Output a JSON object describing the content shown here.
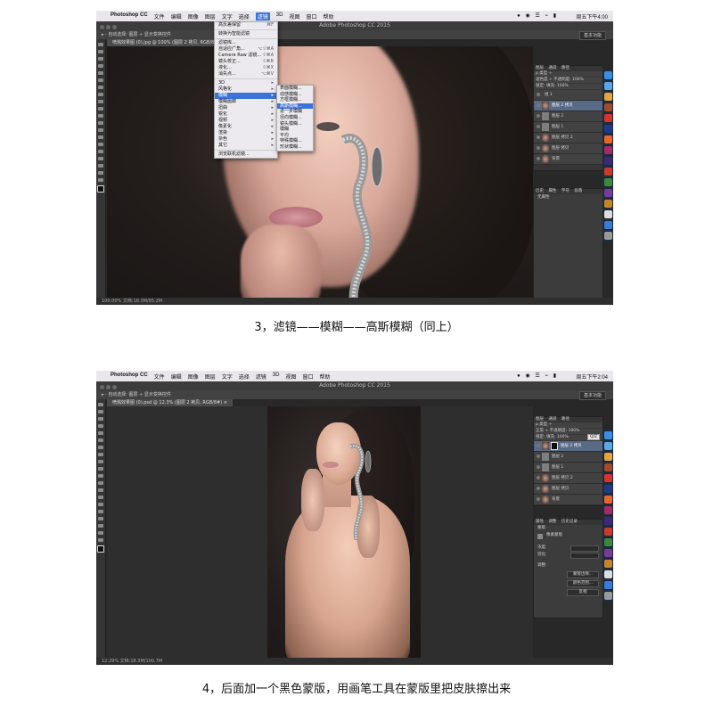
{
  "shot1": {
    "mac_menu": [
      "Photoshop CC",
      "文件",
      "编辑",
      "图像",
      "图层",
      "文字",
      "选择",
      "滤镜",
      "3D",
      "视图",
      "窗口",
      "帮助"
    ],
    "mac_menu_selected": "滤镜",
    "clock": "周五下午4:00",
    "window_title": "Adobe Photoshop CC 2015",
    "options": "▸ ·   自动选择: 图层 ÷   显示变换控件",
    "workspace": "基本功能",
    "doc_tab": "喷溅效果图 (0).jpg @ 100% (图层 2 拷贝, RGB/8#) ×",
    "status": "100.00%    文档:18.3M/95.2M",
    "filter_menu": [
      {
        "label": "高反差保留",
        "key": "⌘F"
      },
      {
        "label": "转换为智能滤镜",
        "key": ""
      },
      {
        "label": "滤镜库...",
        "key": ""
      },
      {
        "label": "自适应广角...",
        "key": "⌥⇧⌘A"
      },
      {
        "label": "Camera Raw 滤镜...",
        "key": "⇧⌘A"
      },
      {
        "label": "镜头校正...",
        "key": "⇧⌘R"
      },
      {
        "label": "液化...",
        "key": "⇧⌘X"
      },
      {
        "label": "消失点...",
        "key": "⌥⌘V"
      },
      {
        "label": "3D",
        "key": "▸"
      },
      {
        "label": "风格化",
        "key": "▸"
      },
      {
        "label": "模糊",
        "key": "▸"
      },
      {
        "label": "模糊画廊",
        "key": "▸"
      },
      {
        "label": "扭曲",
        "key": "▸"
      },
      {
        "label": "锐化",
        "key": "▸"
      },
      {
        "label": "视频",
        "key": "▸"
      },
      {
        "label": "像素化",
        "key": "▸"
      },
      {
        "label": "渲染",
        "key": "▸"
      },
      {
        "label": "杂色",
        "key": "▸"
      },
      {
        "label": "其它",
        "key": "▸"
      },
      {
        "label": "浏览联机滤镜...",
        "key": ""
      }
    ],
    "blur_submenu": [
      "表面模糊...",
      "动感模糊...",
      "方框模糊...",
      "高斯模糊...",
      "进一步模糊",
      "径向模糊...",
      "镜头模糊...",
      "模糊",
      "平均",
      "特殊模糊...",
      "形状模糊..."
    ],
    "layers_tabs": [
      "图层",
      "通道",
      "路径"
    ],
    "layers_rows": [
      "ρ 类型 ÷",
      "滤色度 ÷   不透明度: 100%",
      "锁定:   填充: 100%"
    ],
    "layers": [
      "组 1",
      "图层 2 拷贝",
      "图层 2",
      "图层 1",
      "图层 拷贝 2",
      "图层 拷贝",
      "背景"
    ],
    "sub_tabs": [
      "历史",
      "属性",
      "字符",
      "段落"
    ],
    "sub_rows": [
      "无属性"
    ]
  },
  "caption1": "3，滤镜——模糊——高斯模糊（同上）",
  "shot2": {
    "mac_menu": [
      "Photoshop CC",
      "文件",
      "编辑",
      "图像",
      "图层",
      "文字",
      "选择",
      "滤镜",
      "3D",
      "视图",
      "窗口",
      "帮助"
    ],
    "clock": "周五下午2:04",
    "window_title": "Adobe Photoshop CC 2015",
    "options": "▸ ·   自动选择: 图层 ÷   显示变换控件",
    "workspace": "基本功能",
    "doc_tab": "喷溅效果图 (0).psd @ 12.3% (图层 2 拷贝, RGB/8#) ×",
    "status": "12.29%    文档:18.3M/100.7M",
    "layers_tabs": [
      "图层",
      "通道",
      "路径"
    ],
    "layers_rows": [
      "ρ 类型 ÷",
      "正常 ÷   不透明度: 100%",
      "锁定:   填充: 100%"
    ],
    "layers": [
      "图层 2 拷贝",
      "图层 2",
      "图层 1",
      "图层 拷贝 2",
      "图层 拷贝",
      "背景"
    ],
    "tooltip": "Q/Z",
    "props_tabs": [
      "属性",
      "调整",
      "历史记录"
    ],
    "props_title": "蒙版",
    "props_mask": "像素蒙版",
    "props_labels": [
      "浓度:",
      "羽化:",
      "调整:"
    ],
    "props_buttons": [
      "蒙版边缘...",
      "颜色范围...",
      "反相"
    ]
  },
  "caption2": "4，后面加一个黑色蒙版，用画笔工具在蒙版里把皮肤擦出来"
}
